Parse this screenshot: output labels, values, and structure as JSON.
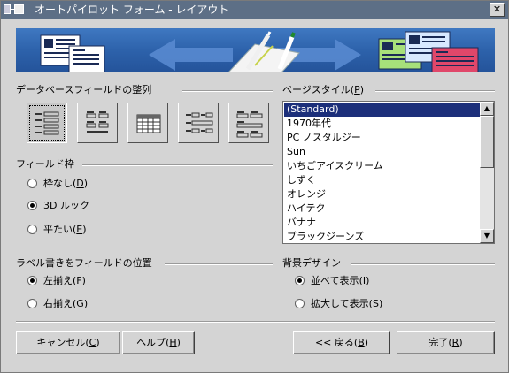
{
  "window": {
    "title": "オートパイロット フォーム - レイアウト",
    "close_label": "✕"
  },
  "arrangement": {
    "label": "データベースフィールドの整列",
    "options": [
      {
        "name": "columnar-left-labels",
        "selected": true
      },
      {
        "name": "columnar-top-labels",
        "selected": false
      },
      {
        "name": "datasheet",
        "selected": false
      },
      {
        "name": "in-blocks-left-labels",
        "selected": false
      },
      {
        "name": "in-blocks-top-labels",
        "selected": false
      }
    ]
  },
  "field_border": {
    "label": "フィールド枠",
    "options": [
      {
        "label": "枠なし",
        "mnemonic": "D",
        "selected": false
      },
      {
        "label": "3D ルック",
        "mnemonic": "",
        "selected": true
      },
      {
        "label": "平たい",
        "mnemonic": "E",
        "selected": false
      }
    ]
  },
  "label_align": {
    "label": "ラベル書きをフィールドの位置",
    "options": [
      {
        "label": "左揃え",
        "mnemonic": "F",
        "selected": true
      },
      {
        "label": "右揃え",
        "mnemonic": "G",
        "selected": false
      }
    ]
  },
  "page_style": {
    "label": "ページスタイル",
    "mnemonic": "P",
    "items": [
      "(Standard)",
      "1970年代",
      "PC ノスタルジー",
      "Sun",
      "いちごアイスクリーム",
      "しずく",
      "オレンジ",
      "ハイテク",
      "バナナ",
      "ブラックジーンズ"
    ],
    "selected_index": 0
  },
  "background": {
    "label": "背景デザイン",
    "options": [
      {
        "label": "並べて表示",
        "mnemonic": "I",
        "selected": true
      },
      {
        "label": "拡大して表示",
        "mnemonic": "S",
        "selected": false
      }
    ]
  },
  "buttons": {
    "cancel": {
      "label": "キャンセル",
      "mnemonic": "C"
    },
    "help": {
      "label": "ヘルプ",
      "mnemonic": "H"
    },
    "back": {
      "label": "<< 戻る",
      "mnemonic": "B"
    },
    "finish": {
      "label": "完了",
      "mnemonic": "R"
    }
  },
  "colors": {
    "title_bar": "#5d6f86",
    "dialog_bg": "#d4d4d4",
    "banner_blue": "#2d62ab",
    "selection": "#1c2f7a"
  }
}
